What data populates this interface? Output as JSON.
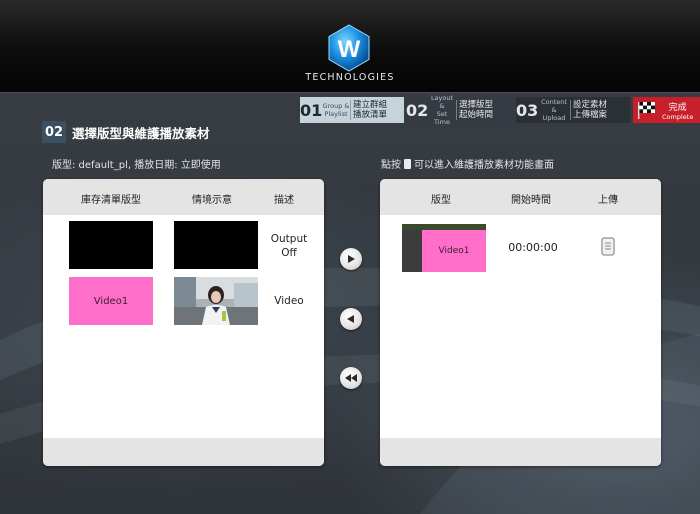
{
  "header": {
    "logo_letter": "W",
    "brand": "TECHNOLOGIES"
  },
  "steps": [
    {
      "num": "01",
      "en_line1": "Group &",
      "en_line2": "Playlist",
      "zh_line1": "建立群組",
      "zh_line2": "播放清單"
    },
    {
      "num": "02",
      "en_line1": "Layout &",
      "en_line2": "Set Time",
      "zh_line1": "選擇版型",
      "zh_line2": "起始時間"
    },
    {
      "num": "03",
      "en_line1": "Content &",
      "en_line2": "Upload",
      "zh_line1": "設定素材",
      "zh_line2": "上傳檔案"
    },
    {
      "zh": "完成",
      "en": "Complete"
    }
  ],
  "section": {
    "badge": "02",
    "title": "選擇版型與維護播放素材"
  },
  "info": {
    "left": "版型: default_pl, 播放日期: 立即使用",
    "hint_prefix": "點按",
    "hint_suffix": "可以進入維護播放素材功能畫面"
  },
  "left_panel": {
    "headers": [
      "庫存清單版型",
      "情境示意",
      "描述"
    ],
    "rows": [
      {
        "layout_label": "",
        "desc_line1": "Output",
        "desc_line2": "Off"
      },
      {
        "layout_label": "Video1",
        "desc_line1": "Video",
        "desc_line2": ""
      }
    ]
  },
  "right_panel": {
    "headers": [
      "版型",
      "開始時間",
      "上傳"
    ],
    "rows": [
      {
        "layout_label": "Video1",
        "start_time": "00:00:00"
      }
    ]
  },
  "colors": {
    "accent_pink": "#ff6fc9",
    "complete_red": "#c8202a",
    "step_active": "#c5d3db"
  }
}
